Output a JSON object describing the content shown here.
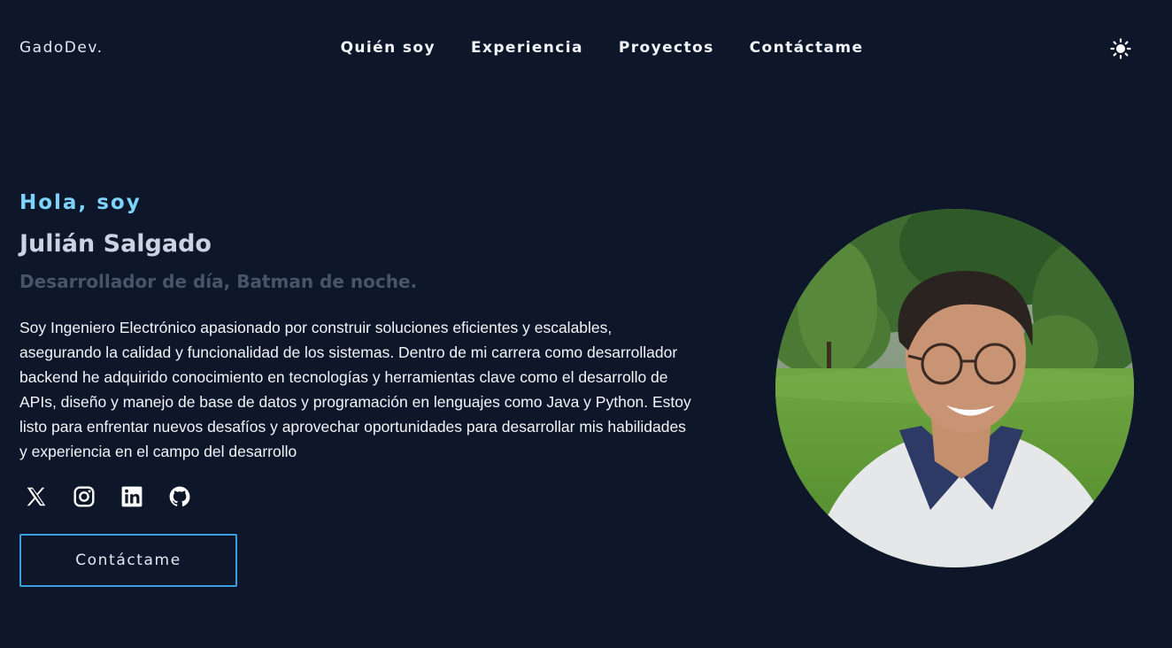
{
  "header": {
    "logo": "GadoDev.",
    "nav": [
      {
        "label": "Quién soy"
      },
      {
        "label": "Experiencia"
      },
      {
        "label": "Proyectos"
      },
      {
        "label": "Contáctame"
      }
    ],
    "theme_icon": "sun-icon"
  },
  "hero": {
    "greeting": "Hola, soy",
    "name": "Julián Salgado",
    "tagline": "Desarrollador de día, Batman de noche.",
    "bio": "Soy Ingeniero Electrónico apasionado por construir soluciones eficientes y escalables, asegurando la calidad y funcionalidad de los sistemas. Dentro de mi carrera como desarrollador backend he adquirido conocimiento en tecnologías y herramientas clave como el desarrollo de APIs, diseño y manejo de base de datos y programación en lenguajes como Java y Python. Estoy listo para enfrentar nuevos desafíos y aprovechar oportunidades para desarrollar mis habilidades y experiencia en el campo del desarrollo",
    "socials": [
      "x-icon",
      "instagram-icon",
      "linkedin-icon",
      "github-icon"
    ],
    "cta_label": "Contáctame"
  },
  "colors": {
    "background": "#0e172a",
    "accent": "#7dd3fc",
    "button_border": "#3b9ede",
    "muted": "#475569"
  }
}
